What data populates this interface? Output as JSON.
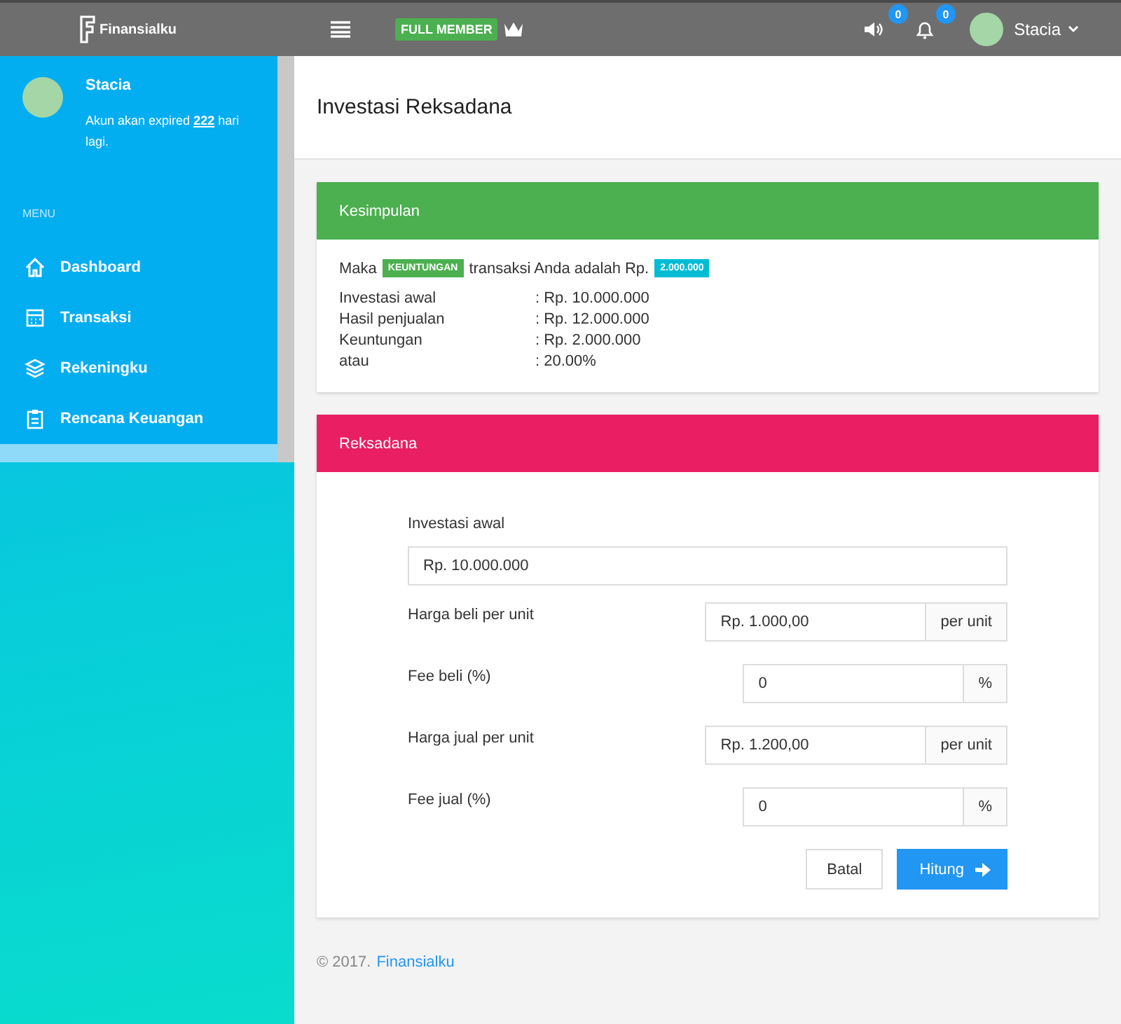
{
  "topbar": {
    "logo": "Finansialku",
    "badge": "FULL MEMBER",
    "sound_count": "0",
    "bell_count": "0",
    "user": "Stacia"
  },
  "profile": {
    "name": "Stacia",
    "expiry": "Akun akan expired **222** hari lagi."
  },
  "menu": {
    "heading": "MENU",
    "items": [
      {
        "label": "Dashboard"
      },
      {
        "label": "Transaksi"
      },
      {
        "label": "Rekeningku"
      },
      {
        "label": "Rencana Keuangan"
      }
    ]
  },
  "page_title": "Investasi Reksadana",
  "summary": {
    "title": "Kesimpulan",
    "prefix": "Maka",
    "result_tag": "KEUNTUNGAN",
    "middle": "transaksi Anda adalah Rp.",
    "amount": "2.000.000",
    "rows": [
      {
        "label": "Investasi awal",
        "value": ": Rp. 10.000.000"
      },
      {
        "label": "Hasil penjualan",
        "value": ": Rp. 12.000.000"
      },
      {
        "label": "Keuntungan",
        "value": ": Rp. 2.000.000"
      },
      {
        "label": "atau",
        "value": ": 20.00%"
      }
    ]
  },
  "form": {
    "title": "Reksadana",
    "fields": [
      {
        "label": "Investasi awal",
        "value": "Rp. 10.000.000",
        "kind": "full"
      },
      {
        "label": "Harga beli per unit",
        "value": "Rp. 1.000,00",
        "addon": "per unit",
        "kind": "addon"
      },
      {
        "label": "Fee beli (%)",
        "value": "0",
        "addon": "%",
        "kind": "addon"
      },
      {
        "label": "Harga jual per unit",
        "value": "Rp. 1.200,00",
        "addon": "per unit",
        "kind": "addon"
      },
      {
        "label": "Fee jual (%)",
        "value": "0",
        "addon": "%",
        "kind": "addon"
      }
    ],
    "cancel": "Batal",
    "submit": "Hitung"
  },
  "footer": {
    "prefix": "© 2017.",
    "link": "Finansialku"
  }
}
